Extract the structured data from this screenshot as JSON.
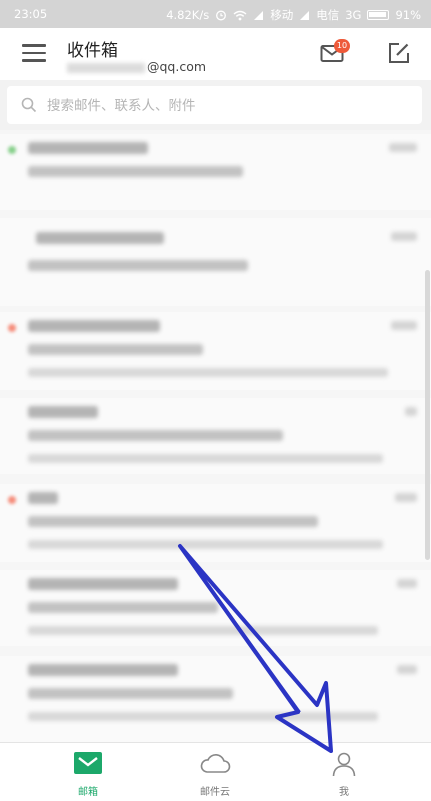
{
  "status_bar": {
    "time": "23:05",
    "network_speed": "4.82K/s",
    "carrier1": "移动",
    "carrier2": "电信",
    "network": "3G",
    "battery": "91%"
  },
  "header": {
    "title": "收件箱",
    "account_suffix": "@qq.com",
    "unread_badge": "10"
  },
  "search": {
    "placeholder": "搜索邮件、联系人、附件"
  },
  "mail_list": {
    "items": [
      {
        "sender": "blurred",
        "subject": "blurred",
        "preview": "",
        "date": "blurred",
        "unread": true,
        "dot": "green"
      },
      {
        "sender": "blurred",
        "subject": "blurred",
        "preview": "",
        "date": "blurred",
        "unread": false,
        "dot": ""
      },
      {
        "sender": "blurred",
        "subject": "blurred",
        "preview": "blurred",
        "date": "blurred",
        "unread": true,
        "dot": "red"
      },
      {
        "sender": "blurred",
        "subject": "blurred",
        "preview": "blurred",
        "date": "blurred",
        "unread": false,
        "dot": ""
      },
      {
        "sender": "blurred",
        "subject": "blurred",
        "preview": "blurred",
        "date": "blurred",
        "unread": true,
        "dot": "red"
      },
      {
        "sender": "blurred",
        "subject": "blurred",
        "preview": "blurred",
        "date": "blurred",
        "unread": false,
        "dot": ""
      },
      {
        "sender": "blurred",
        "subject": "blurred",
        "preview": "blurred",
        "date": "blurred",
        "unread": false,
        "dot": ""
      }
    ]
  },
  "tabbar": {
    "tabs": [
      {
        "label": "邮箱",
        "icon": "mail-icon",
        "active": true
      },
      {
        "label": "邮件云",
        "icon": "cloud-icon",
        "active": false
      },
      {
        "label": "我",
        "icon": "person-icon",
        "active": false
      }
    ]
  },
  "colors": {
    "accent": "#1ca86a",
    "badge": "#ee5a3a",
    "annotation_arrow": "#2b34c4"
  }
}
